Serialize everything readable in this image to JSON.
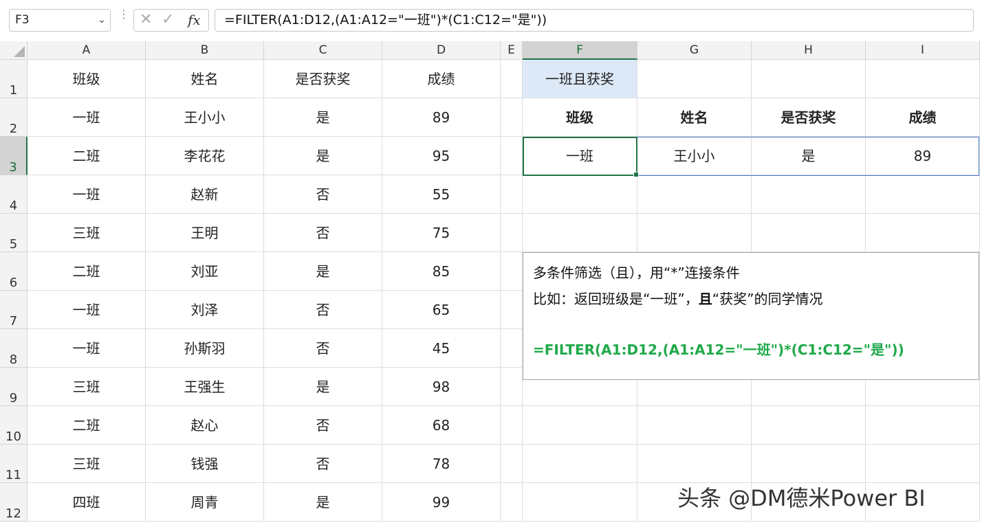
{
  "formula_bar": {
    "name_box": "F3",
    "dots": "⋮",
    "cancel": "✕",
    "enter": "✓",
    "fx": "fx",
    "formula": "=FILTER(A1:D12,(A1:A12=\"一班\")*(C1:C12=\"是\"))"
  },
  "columns": [
    "A",
    "B",
    "C",
    "D",
    "E",
    "F",
    "G",
    "H",
    "I"
  ],
  "rows": [
    "1",
    "2",
    "3",
    "4",
    "5",
    "6",
    "7",
    "8",
    "9",
    "10",
    "11",
    "12"
  ],
  "selected_cell": "F3",
  "table": {
    "headers": [
      "班级",
      "姓名",
      "是否获奖",
      "成绩"
    ],
    "rows": [
      [
        "一班",
        "王小小",
        "是",
        "89"
      ],
      [
        "二班",
        "李花花",
        "是",
        "95"
      ],
      [
        "一班",
        "赵新",
        "否",
        "55"
      ],
      [
        "三班",
        "王明",
        "否",
        "75"
      ],
      [
        "二班",
        "刘亚",
        "是",
        "85"
      ],
      [
        "一班",
        "刘泽",
        "否",
        "65"
      ],
      [
        "一班",
        "孙斯羽",
        "否",
        "45"
      ],
      [
        "三班",
        "王强生",
        "是",
        "98"
      ],
      [
        "二班",
        "赵心",
        "否",
        "68"
      ],
      [
        "三班",
        "钱强",
        "否",
        "78"
      ],
      [
        "四班",
        "周青",
        "是",
        "99"
      ]
    ]
  },
  "result": {
    "title": "一班且获奖",
    "headers": [
      "班级",
      "姓名",
      "是否获奖",
      "成绩"
    ],
    "row": [
      "一班",
      "王小小",
      "是",
      "89"
    ]
  },
  "note": {
    "line1": "多条件筛选（且），用“*”连接条件",
    "line2_a": "比如：返回班级是“一班”，",
    "line2_b": "且",
    "line2_c": "“获奖”的同学情况",
    "formula": "=FILTER(A1:D12,(A1:A12=\"一班\")*(C1:C12=\"是\"))"
  },
  "watermark": "头条 @DM德米Power BI",
  "colors": {
    "accent": "#217346",
    "formula_text": "#1fa94a",
    "highlight": "#dde9f7"
  }
}
